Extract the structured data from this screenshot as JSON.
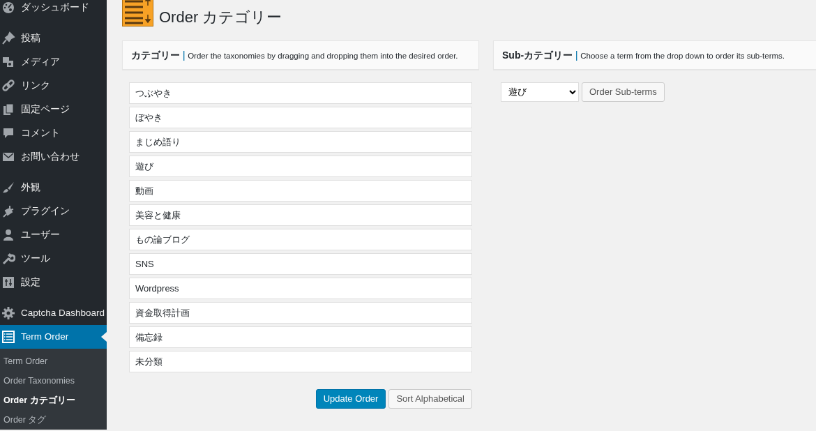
{
  "sidebar": {
    "groups": [
      [
        {
          "label": "ダッシュボード",
          "selected": false
        }
      ],
      [
        {
          "label": "投稿",
          "selected": false
        },
        {
          "label": "メディア",
          "selected": false
        },
        {
          "label": "リンク",
          "selected": false
        },
        {
          "label": "固定ページ",
          "selected": false
        },
        {
          "label": "コメント",
          "selected": false
        },
        {
          "label": "お問い合わせ",
          "selected": false
        }
      ],
      [
        {
          "label": "外観",
          "selected": false
        },
        {
          "label": "プラグイン",
          "selected": false
        },
        {
          "label": "ユーザー",
          "selected": false
        },
        {
          "label": "ツール",
          "selected": false
        },
        {
          "label": "設定",
          "selected": false
        }
      ],
      [
        {
          "label": "Captcha Dashboard",
          "selected": false
        },
        {
          "label": "Term Order",
          "selected": true,
          "children": [
            {
              "label": "Term Order",
              "selected": false
            },
            {
              "label": "Order Taxonomies",
              "selected": false
            },
            {
              "label": "Order カテゴリー",
              "selected": true
            },
            {
              "label": "Order タグ",
              "selected": false
            }
          ]
        }
      ]
    ]
  },
  "page": {
    "title": "Order カテゴリー"
  },
  "left_panel": {
    "title": "カテゴリー",
    "separator": "|",
    "description": "Order the taxonomies by dragging and dropping them into the desired order.",
    "terms": [
      "つぶやき",
      "ぼやき",
      "まじめ語り",
      "遊び",
      "動画",
      "美容と健康",
      "もの論ブログ",
      "SNS",
      "Wordpress",
      "資金取得計画",
      "備忘録",
      "未分類"
    ],
    "buttons": [
      {
        "label": "Update Order",
        "kind": "primary"
      },
      {
        "label": "Sort Alphabetical",
        "kind": "secondary"
      }
    ]
  },
  "right_panel": {
    "title": "Sub-カテゴリー",
    "separator": "|",
    "description": "Choose a term from the drop down to order its sub-terms.",
    "select": {
      "value": "遊び"
    },
    "button": {
      "label": "Order Sub-terms"
    }
  }
}
